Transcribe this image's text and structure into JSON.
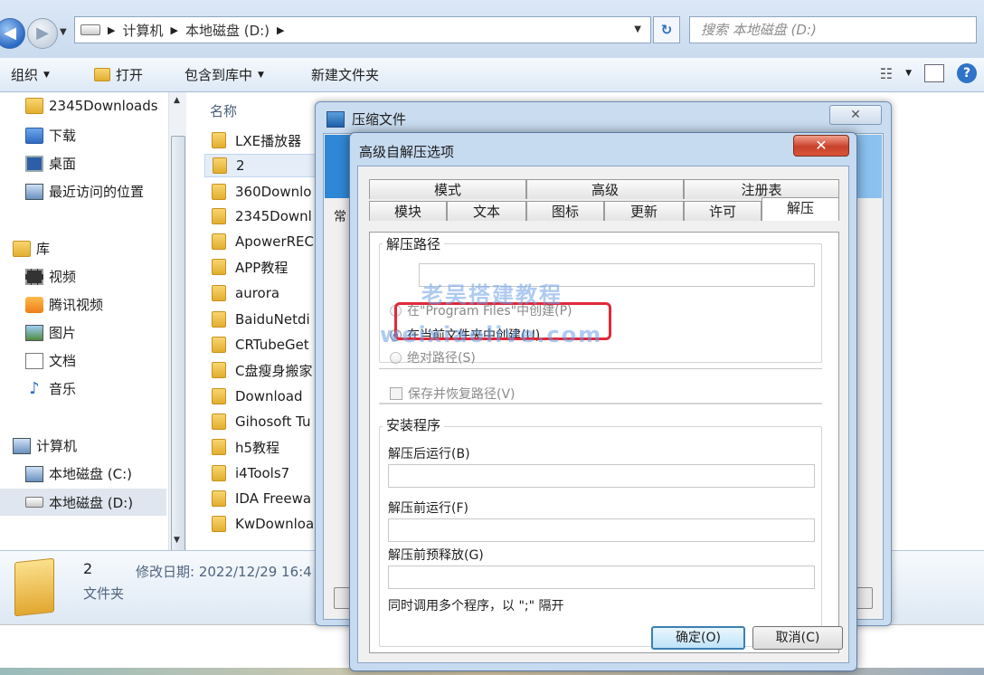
{
  "address": {
    "crumbs": [
      "计算机",
      "本地磁盘 (D:)"
    ],
    "search_placeholder": "搜索 本地磁盘 (D:)"
  },
  "toolbar": {
    "organize": "组织",
    "open": "打开",
    "include_library": "包含到库中",
    "new_folder": "新建文件夹"
  },
  "sidebar": {
    "favorites": [
      "2345Downloads",
      "下载",
      "桌面",
      "最近访问的位置"
    ],
    "library_label": "库",
    "libraries": [
      "视频",
      "腾讯视频",
      "图片",
      "文档",
      "音乐"
    ],
    "computer_label": "计算机",
    "drives": [
      "本地磁盘 (C:)",
      "本地磁盘 (D:)"
    ]
  },
  "filelist": {
    "column_name": "名称",
    "files": [
      "LXE播放器",
      "2",
      "360Downlo",
      "2345Downl",
      "ApowerREC",
      "APP教程",
      "aurora",
      "BaiduNetdi",
      "CRTubeGet",
      "C盘瘦身搬家",
      "Download",
      "Gihosoft Tu",
      "h5教程",
      "i4Tools7",
      "IDA Freewa",
      "KwDownloa"
    ]
  },
  "details": {
    "name": "2",
    "modified": "修改日期: 2022/12/29 16:4",
    "type": "文件夹"
  },
  "back_window": {
    "title": "压缩文件",
    "tab_stub": "常"
  },
  "dialog": {
    "title": "高级自解压选项",
    "close_glyph": "✕",
    "tabs_row1": [
      "模式",
      "高级",
      "注册表"
    ],
    "tabs_row2": [
      "模块",
      "文本",
      "图标",
      "更新",
      "许可",
      "解压"
    ],
    "extract_path_label": "解压路径",
    "extract_path_value": "",
    "radio_program_files": "在\"Program Files\"中创建(P)",
    "radio_current_folder": "在当前文件夹中创建(U)",
    "radio_absolute": "绝对路径(S)",
    "save_restore_paths": "保存并恢复路径(V)",
    "setup_label": "安装程序",
    "run_after_label": "解压后运行(B)",
    "run_before_label": "解压前运行(F)",
    "pre_extract_label": "解压前预释放(G)",
    "multi_hint": "同时调用多个程序，以 \";\" 隔开",
    "ok_label": "确定(O)",
    "cancel_label": "取消(C)"
  },
  "watermark": {
    "line1": "老吴搭建教程",
    "line2": "weixiaolive.com"
  }
}
